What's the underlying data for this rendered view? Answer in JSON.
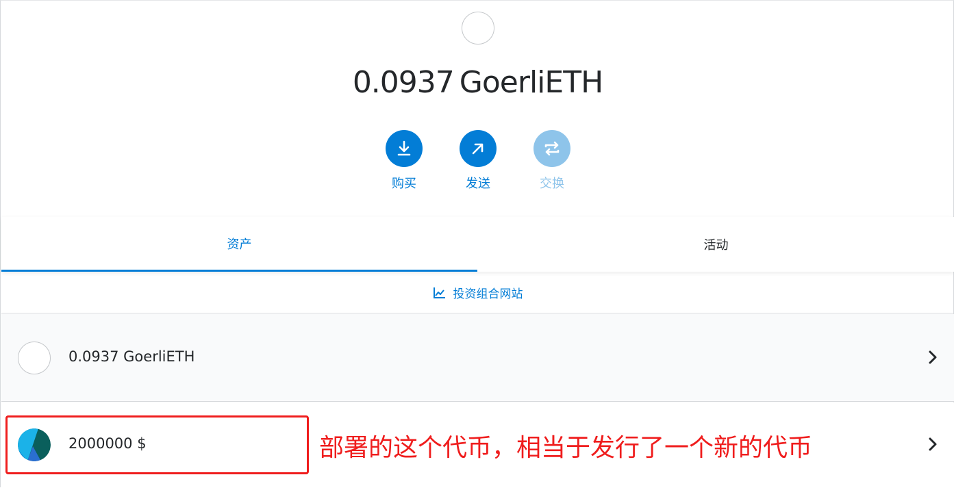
{
  "header": {
    "balance_amount": "0.0937",
    "balance_unit": "GoerliETH"
  },
  "actions": [
    {
      "label": "购买",
      "icon": "download-icon"
    },
    {
      "label": "发送",
      "icon": "arrow-up-right-icon"
    },
    {
      "label": "交换",
      "icon": "swap-icon"
    }
  ],
  "tabs": [
    {
      "label": "资产"
    },
    {
      "label": "活动"
    }
  ],
  "portfolio_link": "投资组合网站",
  "assets": [
    {
      "label": "0.0937 GoerliETH",
      "icon": "eth-identicon"
    },
    {
      "label": "2000000 $",
      "icon": "token-identicon"
    }
  ],
  "annotation": {
    "text": "部署的这个代币，相当于发行了一个新的代币",
    "color": "#ef1d1d"
  },
  "colors": {
    "accent": "#037dd6",
    "disabled": "#8ec4ea"
  }
}
